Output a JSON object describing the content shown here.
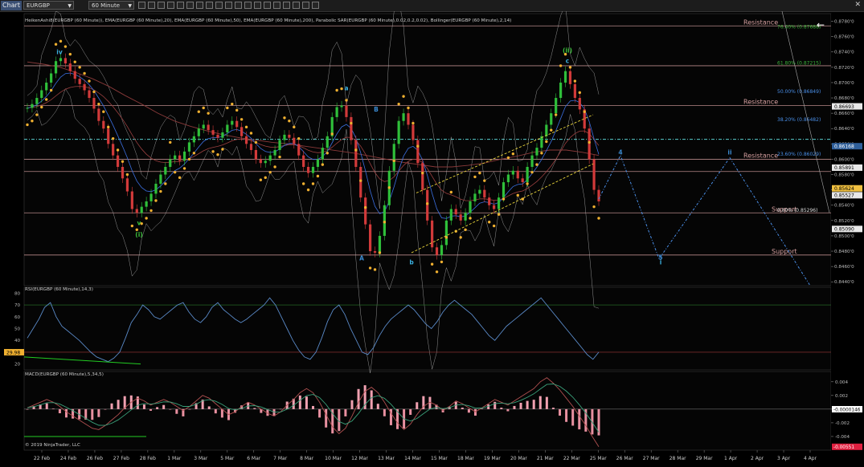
{
  "toolbar": {
    "chart_tab": "Chart",
    "instrument": "EURGBP",
    "interval": "60 Minute"
  },
  "copyright": "© 2019 NinjaTrader, LLC",
  "colors": {
    "background": "#000000",
    "candle_up": "#2fbf3a",
    "candle_down": "#d23a3a",
    "sar": "#f0b030",
    "ema20": "#3b6fe0",
    "ema50": "#9b4040",
    "ema200": "#8a3a3a",
    "bollinger": "#cccccc",
    "level_line": "#d7a0a0",
    "cyan_line": "#5ad0d0",
    "forecast": "#4a8fe8",
    "channel": "#e8d43a",
    "rsi_line": "#5a8ac8",
    "macd_line": "#b05050",
    "macd_signal": "#3aa07a",
    "green_line": "#22cc22"
  },
  "chart_data": [
    {
      "type": "line",
      "indicators_label": "HeikenAshi8(EURGBP (60 Minute)), EMA(EURGBP (60 Minute),20), EMA(EURGBP (60 Minute),50), EMA(EURGBP (60 Minute),200), Parabolic SAR(EURGBP (60 Minute),0.02,0.2,0.02), Bollinger(EURGBP (60 Minute),2,14)",
      "x_labels": [
        "22 Feb",
        "24 Feb",
        "26 Feb",
        "27 Feb",
        "28 Feb",
        "1 Mar",
        "3 Mar",
        "5 Mar",
        "6 Mar",
        "7 Mar",
        "8 Mar",
        "10 Mar",
        "12 Mar",
        "13 Mar",
        "14 Mar",
        "15 Mar",
        "18 Mar",
        "19 Mar",
        "20 Mar",
        "21 Mar",
        "22 Mar",
        "25 Mar",
        "26 Mar",
        "27 Mar",
        "28 Mar",
        "29 Mar",
        "1 Apr",
        "2 Apr",
        "3 Apr",
        "4 Apr"
      ],
      "y_ticks": [
        "0.8780'0",
        "0.8760'0",
        "0.8740'0",
        "0.8720'0",
        "0.8700'0",
        "0.8680'0",
        "0.8660'0",
        "0.8640'0",
        "0.8620'0",
        "0.8600'0",
        "0.8580'0",
        "0.8560'0",
        "0.8540'0",
        "0.8520'0",
        "0.8500'0",
        "0.8480'0",
        "0.8460'0",
        "0.8440'0"
      ],
      "ylim": [
        0.8435,
        0.879
      ],
      "price_series_bars": [
        0.8667,
        0.8672,
        0.868,
        0.869,
        0.87,
        0.8712,
        0.8728,
        0.8732,
        0.8725,
        0.8715,
        0.8705,
        0.8698,
        0.869,
        0.868,
        0.8666,
        0.865,
        0.864,
        0.862,
        0.8605,
        0.859,
        0.8575,
        0.8558,
        0.8535,
        0.853,
        0.8538,
        0.8545,
        0.8555,
        0.8568,
        0.858,
        0.859,
        0.86,
        0.8605,
        0.8598,
        0.861,
        0.8622,
        0.863,
        0.864,
        0.8645,
        0.8638,
        0.8632,
        0.8628,
        0.8635,
        0.8645,
        0.865,
        0.8642,
        0.863,
        0.862,
        0.8612,
        0.86,
        0.8595,
        0.8598,
        0.8605,
        0.8612,
        0.8625,
        0.8632,
        0.8628,
        0.862,
        0.8605,
        0.859,
        0.8582,
        0.859,
        0.86,
        0.8615,
        0.863,
        0.8655,
        0.8668,
        0.867,
        0.8655,
        0.8625,
        0.859,
        0.855,
        0.8515,
        0.848,
        0.8478,
        0.85,
        0.854,
        0.8585,
        0.862,
        0.865,
        0.866,
        0.8645,
        0.8625,
        0.8595,
        0.856,
        0.852,
        0.8485,
        0.8475,
        0.8488,
        0.852,
        0.8535,
        0.8528,
        0.852,
        0.853,
        0.8545,
        0.8555,
        0.856,
        0.855,
        0.854,
        0.8535,
        0.855,
        0.857,
        0.858,
        0.8585,
        0.8575,
        0.857,
        0.859,
        0.8605,
        0.8615,
        0.863,
        0.8645,
        0.866,
        0.868,
        0.87,
        0.8715,
        0.8698,
        0.868,
        0.8665,
        0.864,
        0.86,
        0.856,
        0.8545
      ],
      "ema200_series": [
        0.8727,
        0.8724,
        0.872,
        0.8713,
        0.8705,
        0.8695,
        0.8683,
        0.8672,
        0.866,
        0.865,
        0.8643,
        0.8637,
        0.8632,
        0.8628,
        0.8625,
        0.8622,
        0.862,
        0.8617,
        0.8614,
        0.8611,
        0.8608,
        0.8604,
        0.86,
        0.8596,
        0.8593,
        0.859,
        0.859,
        0.8592,
        0.8595,
        0.86,
        0.8604,
        0.8609,
        0.8612,
        0.8612,
        0.8609,
        0.8605
      ],
      "levels": [
        {
          "name": "Resistance",
          "value": 0.8774
        },
        {
          "name": "",
          "value": 0.8722
        },
        {
          "name": "Resistance",
          "value": 0.867
        },
        {
          "name": "Resistance",
          "value": 0.86
        },
        {
          "name": "",
          "value": 0.8584
        },
        {
          "name": "Support",
          "value": 0.853
        },
        {
          "name": "Support",
          "value": 0.8475
        }
      ],
      "cyan_level": 0.8626,
      "fib_levels": [
        {
          "label": "76.40% (0.87688)",
          "value": 0.8769,
          "color": "#3ab03a"
        },
        {
          "label": "61.80% (0.87215)",
          "value": 0.8722,
          "color": "#3ab03a"
        },
        {
          "label": "50.00% (0.86849)",
          "value": 0.8685,
          "color": "#4a8fe8"
        },
        {
          "label": "38.20% (0.86482)",
          "value": 0.8648,
          "color": "#4a8fe8"
        },
        {
          "label": "23.60% (0.86029)",
          "value": 0.8603,
          "color": "#4a8fe8"
        },
        {
          "label": "0.00% (0.85296)",
          "value": 0.853,
          "color": "#dddddd"
        }
      ],
      "price_badges": [
        {
          "label": "0.86693",
          "value": 0.8669,
          "bg": "#e8e8e8",
          "fg": "#000000"
        },
        {
          "label": "0.86168",
          "value": 0.8617,
          "bg": "#2f5f9a",
          "fg": "#ffffff"
        },
        {
          "label": "0.85891",
          "value": 0.8589,
          "bg": "#e8e8e8",
          "fg": "#000000"
        },
        {
          "label": "0.85624",
          "value": 0.8562,
          "bg": "#f0c040",
          "fg": "#000000"
        },
        {
          "label": "0.85527",
          "value": 0.8553,
          "bg": "#e8e8e8",
          "fg": "#000000"
        },
        {
          "label": "0.85090",
          "value": 0.8509,
          "bg": "#e8e8e8",
          "fg": "#000000"
        }
      ],
      "wave_labels": [
        {
          "text": "iv",
          "value": 0.8737,
          "color": "#3ab0e0"
        },
        {
          "text": "v",
          "value": 0.8514,
          "color": "#3ac03a"
        },
        {
          "text": "(i)",
          "value": 0.8507,
          "color": "#3ac03a"
        },
        {
          "text": "a",
          "value": 0.869,
          "color": "#3ab0e0"
        },
        {
          "text": "A",
          "value": 0.8468,
          "color": "#3a8ad0"
        },
        {
          "text": "B",
          "value": 0.8662,
          "color": "#3a8ad0"
        },
        {
          "text": "b",
          "value": 0.8463,
          "color": "#3ab0e0"
        },
        {
          "text": "(ii)",
          "value": 0.8739,
          "color": "#3ac03a"
        },
        {
          "text": "c",
          "value": 0.8732,
          "color": "#3ab0e0"
        },
        {
          "text": "ii",
          "value": 0.8606,
          "color": "#3a8ad0"
        },
        {
          "text": "i",
          "value": 0.8463,
          "color": "#3ab0e0"
        },
        {
          "text": "4",
          "value": 0.8606,
          "color": "#3a8ad0"
        },
        {
          "text": "5",
          "value": 0.8469,
          "color": "#3a8ad0"
        }
      ],
      "forecast_path": [
        [
          0.8548,
          0
        ],
        [
          0.8605,
          1
        ],
        [
          0.847,
          2
        ],
        [
          0.8602,
          3
        ],
        [
          0.8435,
          4
        ]
      ]
    },
    {
      "type": "line",
      "title": "RSI(EURGBP (60 Minute),14,3)",
      "y_ticks": [
        "80",
        "70",
        "60",
        "50",
        "40",
        "30",
        "20"
      ],
      "ylim": [
        15,
        85
      ],
      "upper_band": 70,
      "lower_band": 30,
      "current_label": "29.98",
      "values": [
        42,
        50,
        58,
        68,
        72,
        60,
        52,
        48,
        44,
        40,
        35,
        30,
        26,
        24,
        22,
        25,
        30,
        42,
        55,
        62,
        70,
        66,
        60,
        58,
        62,
        66,
        70,
        72,
        64,
        58,
        55,
        60,
        68,
        72,
        66,
        62,
        58,
        55,
        58,
        62,
        66,
        70,
        76,
        70,
        60,
        50,
        40,
        32,
        26,
        24,
        30,
        42,
        56,
        66,
        70,
        62,
        50,
        40,
        30,
        28,
        34,
        44,
        52,
        58,
        62,
        66,
        70,
        66,
        60,
        54,
        50,
        56,
        64,
        70,
        74,
        70,
        66,
        62,
        56,
        50,
        44,
        40,
        46,
        52,
        56,
        60,
        64,
        68,
        72,
        76,
        70,
        64,
        58,
        52,
        46,
        40,
        34,
        28,
        24,
        30
      ],
      "green_support": [
        26,
        20
      ]
    },
    {
      "type": "bar",
      "title": "MACD(EURGBP (60 Minute),5,34,5)",
      "y_ticks": [
        "0.004",
        "0.002",
        "0",
        "-0.002",
        "-0.004"
      ],
      "ylim": [
        -0.006,
        0.0055
      ],
      "badges": [
        {
          "label": "-0.0000146",
          "value": -1.46e-05,
          "bg": "#ffffff",
          "fg": "#000000"
        },
        {
          "label": "-0.00551",
          "value": -0.00551,
          "bg": "#e02040",
          "fg": "#ffffff"
        }
      ],
      "values": [
        0.0002,
        0.0006,
        0.001,
        0.0014,
        0.001,
        0.0004,
        -0.0004,
        -0.001,
        -0.0016,
        -0.0022,
        -0.0028,
        -0.003,
        -0.0024,
        -0.0016,
        -0.0008,
        0.0002,
        0.001,
        0.0016,
        0.0012,
        0.0006,
        0.001,
        0.0014,
        0.001,
        0.0004,
        -0.0002,
        0.0004,
        0.0012,
        0.002,
        0.0016,
        0.0008,
        0.0,
        -0.0008,
        -0.0004,
        0.0004,
        0.001,
        0.0006,
        0.0,
        -0.0006,
        -0.001,
        -0.0004,
        0.0006,
        0.0014,
        0.0024,
        0.003,
        0.0024,
        0.001,
        -0.0008,
        -0.0026,
        -0.0036,
        -0.0028,
        -0.001,
        0.001,
        0.0026,
        0.0032,
        0.0024,
        0.001,
        -0.0006,
        -0.002,
        -0.003,
        -0.0022,
        -0.0008,
        0.0004,
        0.001,
        0.0006,
        -0.0002,
        0.0004,
        0.0012,
        0.0008,
        0.0002,
        -0.0004,
        0.0002,
        0.0008,
        0.0014,
        0.001,
        0.0006,
        0.0012,
        0.0018,
        0.0024,
        0.003,
        0.004,
        0.0046,
        0.0038,
        0.0028,
        0.0016,
        0.0004,
        -0.001,
        -0.0024,
        -0.004,
        -0.0055
      ],
      "green_support": -0.004
    }
  ]
}
